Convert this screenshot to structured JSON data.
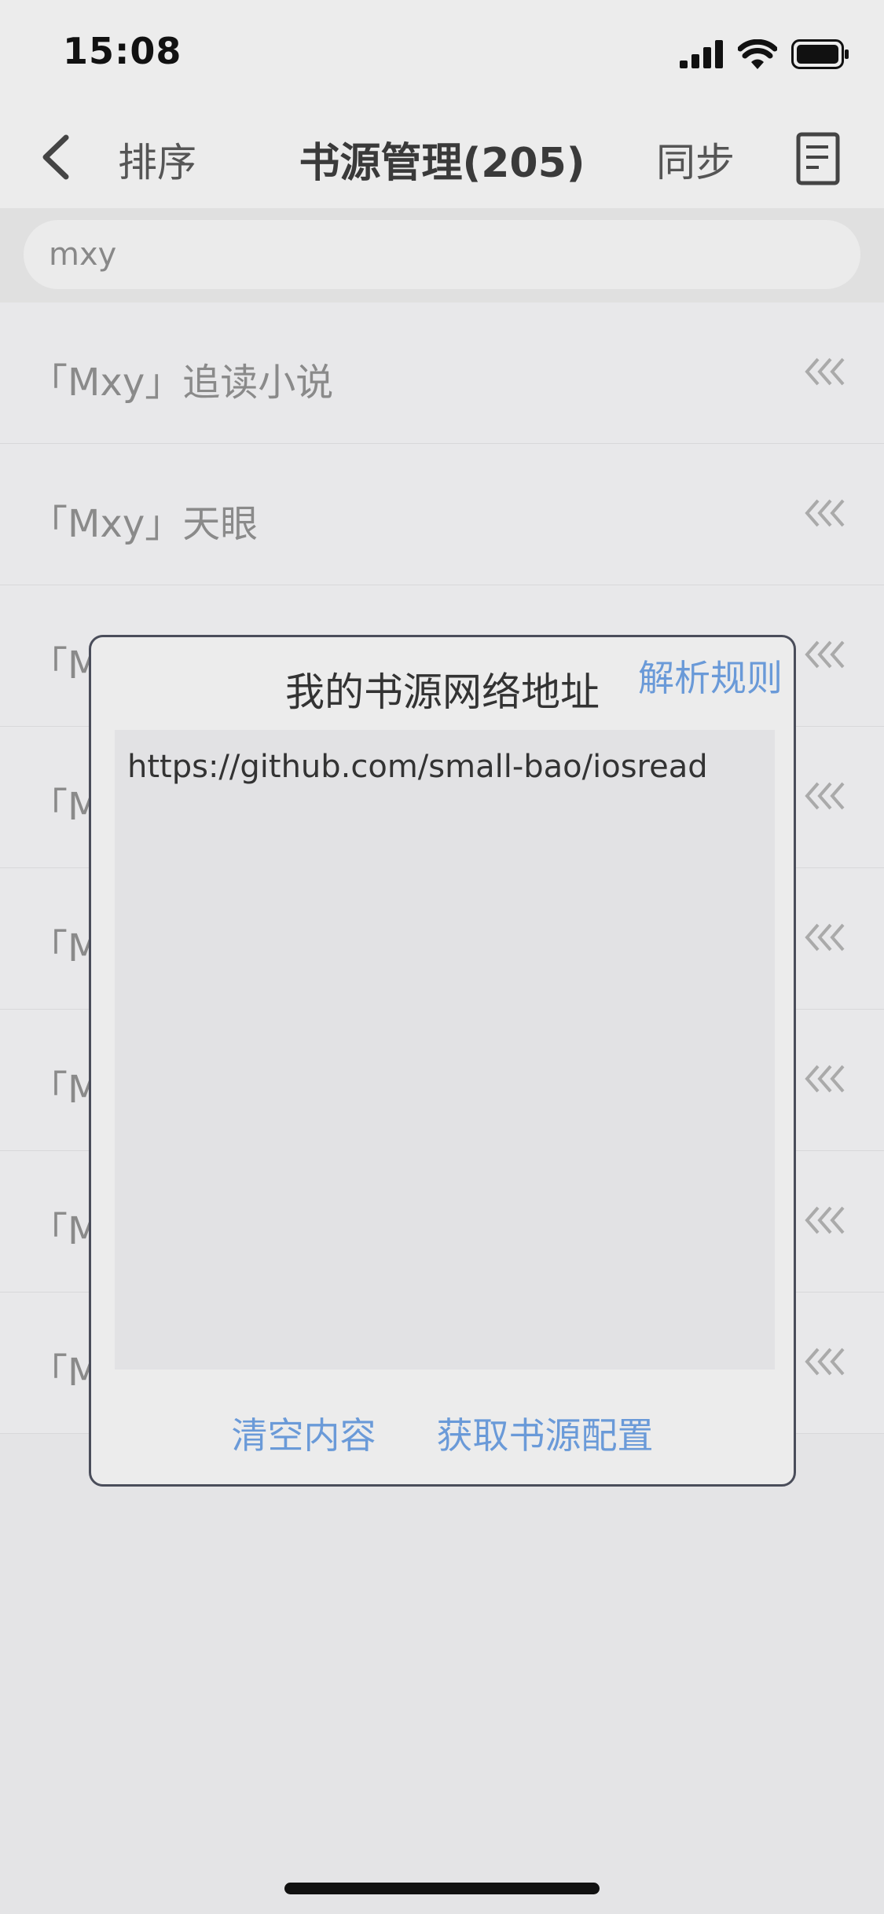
{
  "status_bar": {
    "time": "15:08"
  },
  "nav": {
    "sort_label": "排序",
    "title": "书源管理(205)",
    "sync_label": "同步"
  },
  "search": {
    "value": "mxy"
  },
  "list": {
    "items": [
      {
        "label": "「Mxy」追读小说"
      },
      {
        "label": "「Mxy」天眼"
      },
      {
        "label": "「M"
      },
      {
        "label": "「M"
      },
      {
        "label": "「M"
      },
      {
        "label": "「M"
      },
      {
        "label": "「M"
      },
      {
        "label": "「M"
      }
    ]
  },
  "dialog": {
    "title": "我的书源网络地址",
    "parse_rules_label": "解析规则",
    "url_value": "https://github.com/small-bao/iosread",
    "clear_label": "清空内容",
    "fetch_label": "获取书源配置"
  },
  "colors": {
    "accent": "#6a9ad8",
    "border": "#4a4d5a"
  }
}
